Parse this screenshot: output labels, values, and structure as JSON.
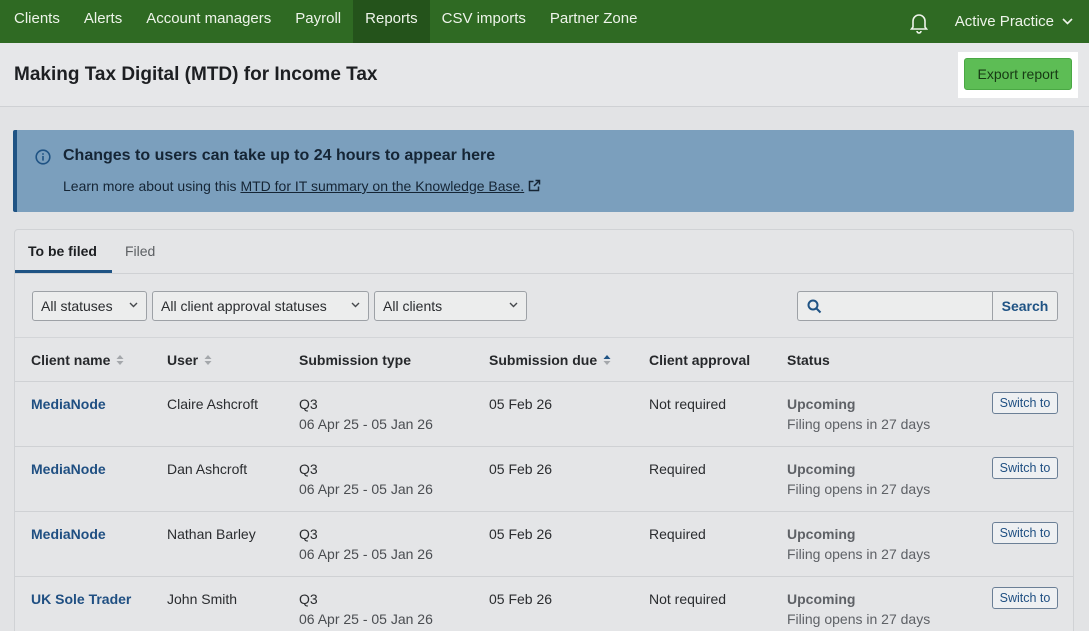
{
  "nav": {
    "items": [
      "Clients",
      "Alerts",
      "Account managers",
      "Payroll",
      "Reports",
      "CSV imports",
      "Partner Zone"
    ],
    "active": "Reports",
    "practice": "Active Practice"
  },
  "header": {
    "title": "Making Tax Digital (MTD) for Income Tax",
    "export_label": "Export report"
  },
  "banner": {
    "title": "Changes to users can take up to 24 hours to appear here",
    "text_prefix": "Learn more about using this ",
    "link": "MTD for IT summary on the Knowledge Base."
  },
  "tabs": [
    "To be filed",
    "Filed"
  ],
  "filters": {
    "statuses": "All statuses",
    "approval": "All client approval statuses",
    "clients": "All clients",
    "search_placeholder": "",
    "search_label": "Search"
  },
  "columns": [
    "Client name",
    "User",
    "Submission type",
    "Submission due",
    "Client approval",
    "Status"
  ],
  "rows": [
    {
      "client": "MediaNode",
      "user": "Claire Ashcroft",
      "type": "Q3",
      "period": "06 Apr 25 - 05 Jan 26",
      "due": "05 Feb 26",
      "approval": "Not required",
      "status": "Upcoming",
      "status_note": "Filing opens in 27 days",
      "action": "Switch to"
    },
    {
      "client": "MediaNode",
      "user": "Dan Ashcroft",
      "type": "Q3",
      "period": "06 Apr 25 - 05 Jan 26",
      "due": "05 Feb 26",
      "approval": "Required",
      "status": "Upcoming",
      "status_note": "Filing opens in 27 days",
      "action": "Switch to"
    },
    {
      "client": "MediaNode",
      "user": "Nathan Barley",
      "type": "Q3",
      "period": "06 Apr 25 - 05 Jan 26",
      "due": "05 Feb 26",
      "approval": "Required",
      "status": "Upcoming",
      "status_note": "Filing opens in 27 days",
      "action": "Switch to"
    },
    {
      "client": "UK Sole Trader",
      "user": "John Smith",
      "type": "Q3",
      "period": "06 Apr 25 - 05 Jan 26",
      "due": "05 Feb 26",
      "approval": "Not required",
      "status": "Upcoming",
      "status_note": "Filing opens in 27 days",
      "action": "Switch to"
    }
  ],
  "icons": {
    "bell": "bell-icon",
    "chevron": "chevron-down-icon",
    "info": "info-icon",
    "external": "external-link-icon",
    "search": "search-icon",
    "sort": "sort-icon",
    "sort_asc": "sort-ascending-icon"
  },
  "colors": {
    "nav_bg": "#2f6a23",
    "accent_green": "#5dbd55",
    "banner_bg": "#7b9fbd",
    "link_blue": "#1f4f82"
  }
}
